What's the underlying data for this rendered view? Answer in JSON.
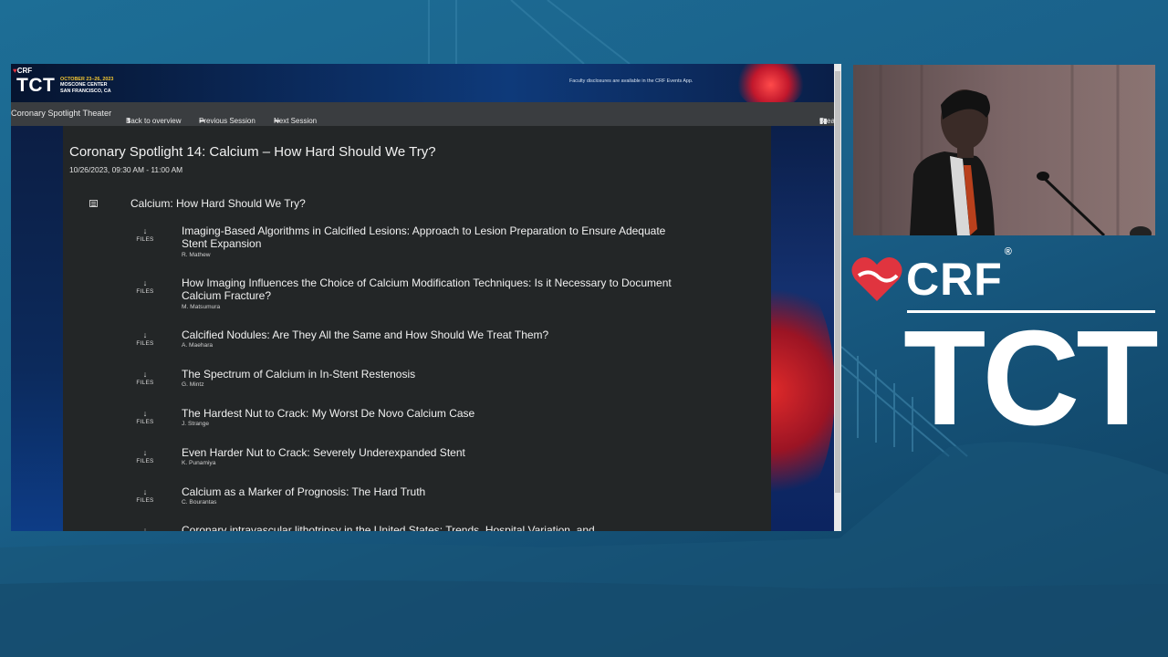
{
  "banner": {
    "crf_label": "CRF",
    "tct_label": "TCT",
    "event_dates": "OCTOBER 23–26, 2023",
    "venue": "MOSCONE CENTER",
    "city": "SAN FRANCISCO, CA",
    "disclosure": "Faculty disclosures are available in the CRF Events App."
  },
  "nav": {
    "theater": "Coronary Spotlight Theater",
    "back": "Back to overview",
    "previous": "Previous Session",
    "next": "Next Session",
    "breakslides": "Breakslides"
  },
  "session": {
    "title": "Coronary Spotlight 14: Calcium – How Hard Should We Try?",
    "time": "10/26/2023, 09:30 AM - 11:00 AM",
    "section_title": "Calcium: How Hard Should We Try?"
  },
  "files_label": "FILES",
  "talks": [
    {
      "title": "Imaging-Based Algorithms in Calcified Lesions: Approach to Lesion Preparation to Ensure Adequate Stent Expansion",
      "speaker": "R. Mathew"
    },
    {
      "title": "How Imaging Influences the Choice of Calcium Modification Techniques: Is it Necessary to Document Calcium Fracture?",
      "speaker": "M. Matsumura"
    },
    {
      "title": "Calcified Nodules: Are They All the Same and How Should We Treat Them?",
      "speaker": "A. Maehara"
    },
    {
      "title": "The Spectrum of Calcium in In-Stent Restenosis",
      "speaker": "G. Mintz"
    },
    {
      "title": "The Hardest Nut to Crack: My Worst De Novo Calcium Case",
      "speaker": "J. Strange"
    },
    {
      "title": "Even Harder Nut to Crack: Severely Underexpanded Stent",
      "speaker": "K. Punamiya"
    },
    {
      "title": "Calcium as a Marker of Prognosis: The Hard Truth",
      "speaker": "C. Bourantas"
    },
    {
      "title": "Coronary intravascular lithotripsy in the United States: Trends, Hospital Variation, and",
      "speaker": ""
    }
  ],
  "logo": {
    "crf": "CRF",
    "registered": "®",
    "tct": "TCT"
  },
  "colors": {
    "background": "#1a6089",
    "screen_bg": "#232627",
    "navbar_bg": "#3a3d40",
    "brand_red": "#e0343f"
  }
}
